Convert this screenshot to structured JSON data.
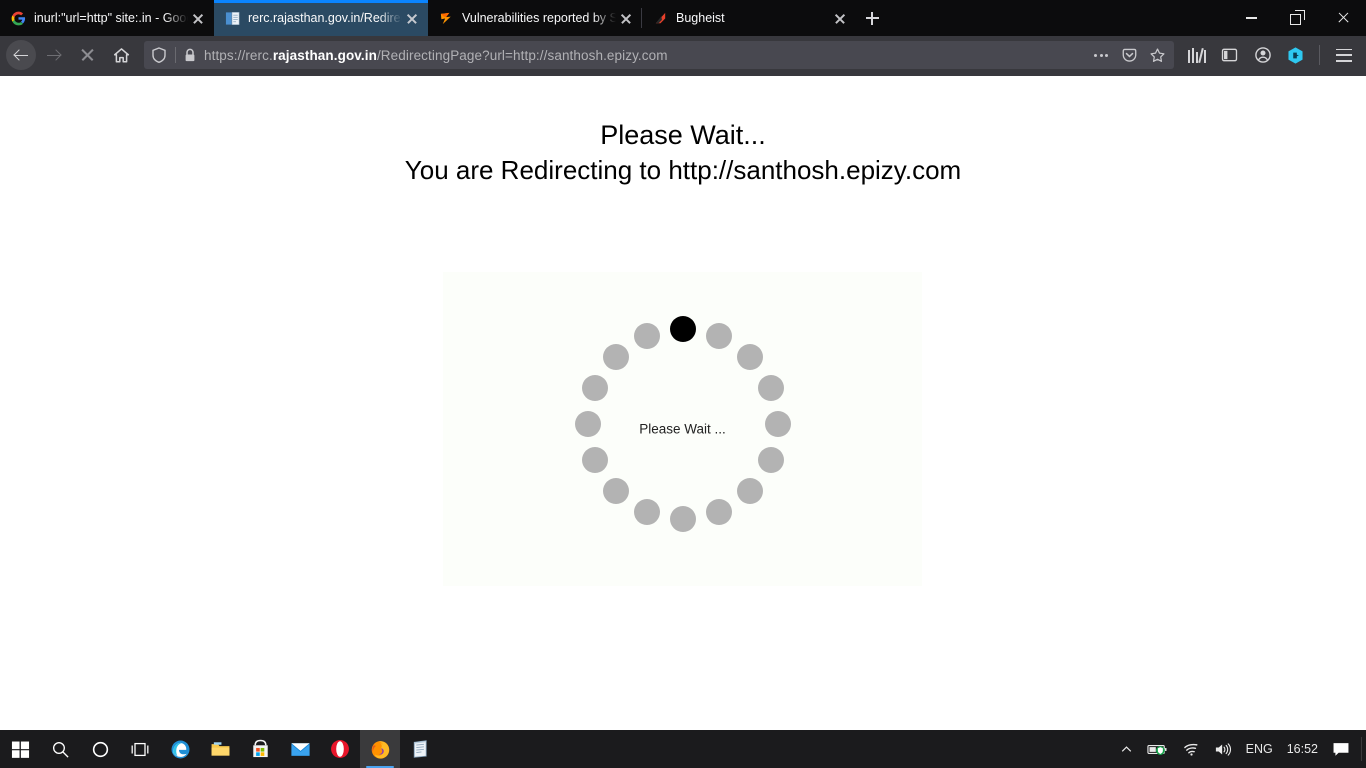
{
  "browser": {
    "tabs": [
      {
        "title": "inurl:\"url=http\" site:.in - Google Search",
        "favicon": "google-icon",
        "active": false
      },
      {
        "title": "rerc.rajasthan.gov.in/RedirectingPage?url=http",
        "favicon": "document-icon",
        "active": true
      },
      {
        "title": "Vulnerabilities reported by Santhosh",
        "favicon": "firefox-icon",
        "active": false
      },
      {
        "title": "Bugheist",
        "favicon": "bugheist-icon",
        "active": false
      }
    ],
    "new_tab_label": "+",
    "window_controls": {
      "minimize": "minimize-button",
      "maximize": "restore-button",
      "close": "close-button"
    },
    "nav": {
      "back": "back-button",
      "forward": "forward-button",
      "stop": "stop-loading-button",
      "home": "home-button"
    },
    "url": {
      "full": "https://rerc.rajasthan.gov.in/RedirectingPage?url=http://santhosh.epizy.com",
      "prefix": "https://rerc.",
      "domain": "rajasthan.gov.in",
      "path": "/RedirectingPage?url=http://santhosh.epizy.com",
      "shield_icon": "tracking-protection-shield-icon",
      "lock_icon": "lock-icon",
      "page_actions_icon": "page-actions-ellipsis-icon",
      "pocket_icon": "pocket-icon",
      "bookmark_icon": "bookmark-star-icon"
    },
    "toolbar_right": {
      "library": "library-icon",
      "sidebar": "sidebar-icon",
      "account": "account-icon",
      "extension": "extension-hexagon-icon",
      "menu": "hamburger-menu-icon"
    }
  },
  "page": {
    "heading_line1": "Please Wait...",
    "heading_line2": "You are Redirecting to http://santhosh.epizy.com",
    "spinner_label": "Please Wait ...",
    "spinner": {
      "dot_count": 16,
      "active_index": 0,
      "dot_color": "#b3b3b3",
      "active_color": "#000000",
      "radius": 95
    },
    "panel_color": "#fcfefa"
  },
  "taskbar": {
    "items": [
      {
        "name": "start-button",
        "icon": "windows-logo-icon"
      },
      {
        "name": "search-button",
        "icon": "search-icon"
      },
      {
        "name": "cortana-button",
        "icon": "cortana-circle-icon"
      },
      {
        "name": "task-view-button",
        "icon": "task-view-icon"
      },
      {
        "name": "edge-button",
        "icon": "edge-icon"
      },
      {
        "name": "file-explorer-button",
        "icon": "folder-icon"
      },
      {
        "name": "microsoft-store-button",
        "icon": "store-icon"
      },
      {
        "name": "mail-button",
        "icon": "mail-icon"
      },
      {
        "name": "opera-button",
        "icon": "opera-icon"
      },
      {
        "name": "firefox-button",
        "icon": "firefox-icon"
      },
      {
        "name": "notepad-button",
        "icon": "notepad-icon"
      }
    ],
    "tray": {
      "overflow": "show-hidden-icons-chevron",
      "battery": "battery-icon",
      "network": "wifi-icon",
      "volume": "volume-icon",
      "language": "ENG",
      "clock": "16:52",
      "action_center": "action-center-icon"
    }
  }
}
